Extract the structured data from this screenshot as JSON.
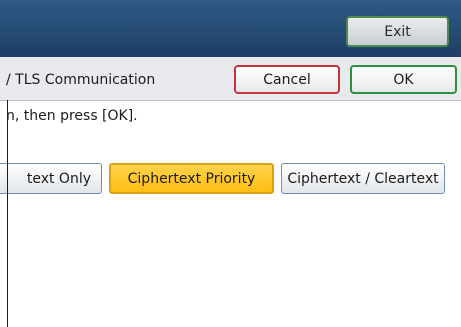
{
  "header": {
    "exit_label": "Exit"
  },
  "dialog": {
    "title": "/ TLS Communication",
    "cancel_label": "Cancel",
    "ok_label": "OK",
    "instruction": "n, then press [OK]."
  },
  "options": {
    "items": [
      {
        "label": "text Only",
        "selected": false
      },
      {
        "label": "Ciphertext Priority",
        "selected": true
      },
      {
        "label": "Ciphertext / Cleartext",
        "selected": false
      }
    ]
  },
  "colors": {
    "header_bg": "#1e3f66",
    "selected_option": "#ffbd12",
    "cancel_border": "#c8323c",
    "ok_border": "#2f8f3f"
  }
}
